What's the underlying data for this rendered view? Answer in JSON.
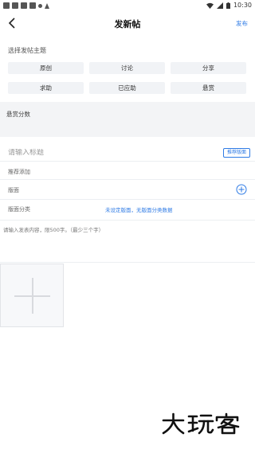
{
  "status_bar": {
    "time": "10:30"
  },
  "header": {
    "title": "发新帖",
    "publish_label": "发布"
  },
  "theme": {
    "label": "选择发帖主题",
    "options": [
      "原创",
      "讨论",
      "分享",
      "求助",
      "已应助",
      "悬赏"
    ]
  },
  "reward": {
    "label": "悬赏分数"
  },
  "title_field": {
    "placeholder": "请输入标题",
    "recommend_label": "推荐版面"
  },
  "rows": {
    "recommend_add": "推荐添加",
    "board": "版面",
    "board_category": "版面分类",
    "board_category_value": "未设定版面，无版面分类数据"
  },
  "content": {
    "placeholder": "请输入发表内容，限500字。（最少三个字）"
  },
  "watermark": {
    "text": "大玩客"
  },
  "colors": {
    "accent": "#2f7be5",
    "chip_bg": "#f1f3f6"
  }
}
